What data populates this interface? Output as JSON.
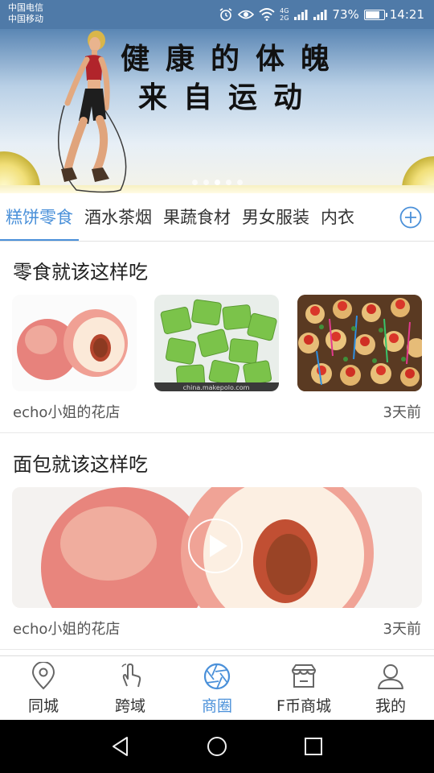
{
  "status_bar": {
    "carrier_1": "中国电信",
    "carrier_2": "中国移动",
    "network_1": "4G",
    "network_2": "2G",
    "battery": "73%",
    "time": "14:21",
    "icons": [
      "alarm-icon",
      "eye-icon",
      "wifi-icon",
      "signal-icon",
      "battery-icon"
    ]
  },
  "banner": {
    "slogan_line_1": "健康的体魄",
    "slogan_line_2": "来自运动",
    "slide_count": 5,
    "active_slide": 3
  },
  "tabs": {
    "items": [
      "糕饼零食",
      "酒水茶烟",
      "果蔬食材",
      "男女服装",
      "内衣"
    ],
    "active_index": 0,
    "add_icon": "plus-circle-icon"
  },
  "feed": [
    {
      "title": "零食就该这样吃",
      "shop": "echo小姐的花店",
      "time": "3天前",
      "images": [
        "peach-image",
        "snack-packs-image",
        "canapes-image"
      ],
      "watermark": "china.makepolo.com"
    },
    {
      "title": "面包就该这样吃",
      "shop": "echo小姐的花店",
      "time": "3天前",
      "media": "peach-video"
    }
  ],
  "bottom_nav": {
    "items": [
      {
        "label": "同城",
        "icon": "location-pin-icon"
      },
      {
        "label": "跨域",
        "icon": "hand-tap-icon"
      },
      {
        "label": "商圈",
        "icon": "aperture-icon"
      },
      {
        "label": "F币商城",
        "icon": "store-icon"
      },
      {
        "label": "我的",
        "icon": "user-icon"
      }
    ],
    "active_index": 2
  },
  "colors": {
    "accent": "#4a90d9",
    "status_bar": "#4f7aa8",
    "text": "#222222",
    "muted": "#555555"
  }
}
